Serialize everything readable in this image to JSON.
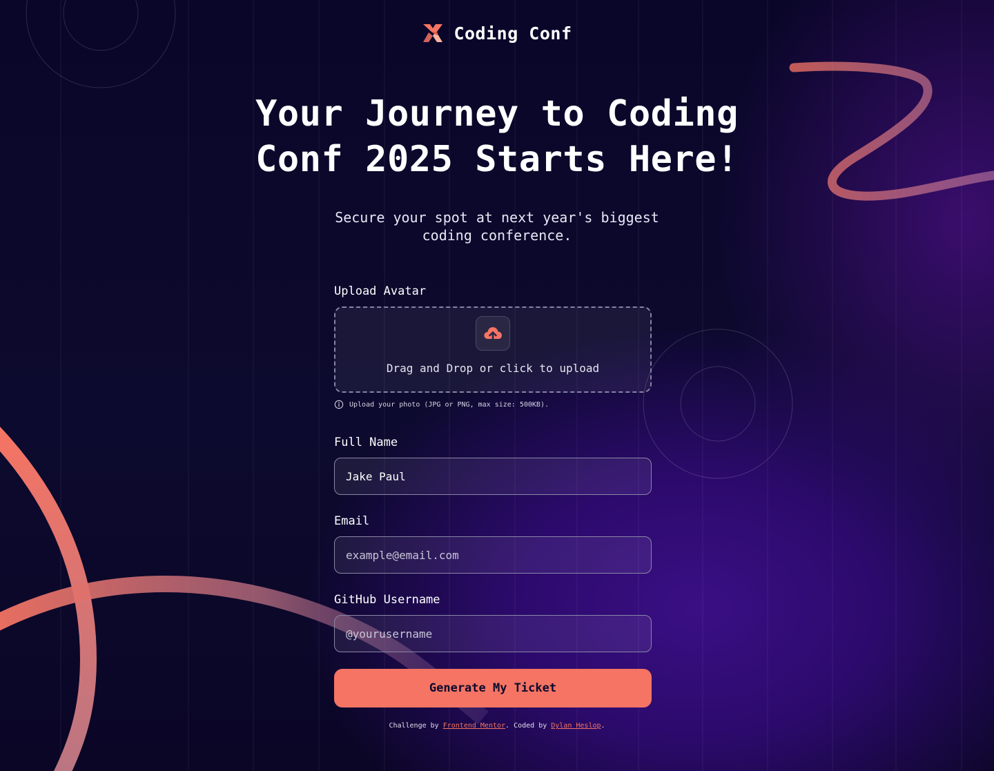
{
  "brand": {
    "name": "Coding Conf",
    "logo_icon": "coding-conf-logo-icon"
  },
  "hero": {
    "title": "Your Journey to Coding Conf 2025 Starts Here!",
    "subtitle": "Secure your spot at next year's biggest coding conference."
  },
  "form": {
    "avatar": {
      "label": "Upload Avatar",
      "dropzone_text": "Drag and Drop or click to upload",
      "hint": "Upload your photo (JPG or PNG, max size: 500KB).",
      "icon": "upload-cloud-icon",
      "hint_icon": "info-icon"
    },
    "full_name": {
      "label": "Full Name",
      "value": "Jake Paul",
      "placeholder": ""
    },
    "email": {
      "label": "Email",
      "value": "",
      "placeholder": "example@email.com"
    },
    "github": {
      "label": "GitHub Username",
      "value": "",
      "placeholder": "@yourusername"
    },
    "submit_label": "Generate My Ticket"
  },
  "footer": {
    "challenge_prefix": "Challenge by ",
    "challenge_link": "Frontend Mentor",
    "coded_prefix": ". Coded by ",
    "author_link": "Dylan Heslop",
    "suffix": "."
  },
  "colors": {
    "accent": "#f57463",
    "background": "#0c0a2e",
    "deep_purple": "#3a0f84"
  }
}
